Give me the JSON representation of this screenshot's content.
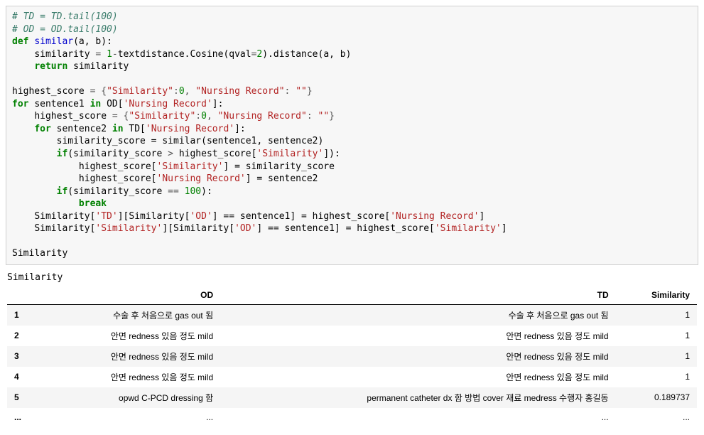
{
  "code": {
    "c1": "# TD = TD.tail(100)",
    "c2": "# OD = OD.tail(100)",
    "def": "def",
    "fn_similar": "similar",
    "args_ab": "(a, b):",
    "sim_var": "similarity",
    "eq": " = ",
    "one": "1",
    "minus": "-",
    "textdistance": "textdistance.Cosine(qval",
    "eq2": "=",
    "two": "2",
    "cosine_tail": ").distance(a, b)",
    "ret": "return",
    "hs": "highest_score",
    "dict_open": " = {",
    "k_sim": "\"Similarity\"",
    "colon": ":",
    "zero": "0",
    "comma": ", ",
    "k_nr": "\"Nursing Record\"",
    "empty": "\"\"",
    "dict_close": "}",
    "for": "for",
    "in": "in",
    "s1": "sentence1",
    "s2": "sentence2",
    "OD": "OD[",
    "TD": "TD[",
    "nr_key": "'Nursing Record'",
    "bracket_close": "]:",
    "ss": "similarity_score",
    "call_similar": " = similar(sentence1, sentence2)",
    "if": "if",
    "gt": " > ",
    "sim_key": "'Similarity'",
    "rb": "]):",
    "assign_ss": " = similarity_score",
    "assign_s2": " = sentence2",
    "eqeq": " == ",
    "hundred": "100",
    "rparen": "):",
    "break": "break",
    "Sim": "Similarity[",
    "td_key": "'TD'",
    "od_key": "'OD'",
    "mid1": "][Similarity[",
    "mid2": "] == sentence1] = highest_score[",
    "close1": "]",
    "sim_key2": "'Similarity'",
    "last": "Similarity"
  },
  "output_text": "Similarity",
  "table": {
    "columns": [
      "",
      "OD",
      "TD",
      "Similarity"
    ],
    "rows": [
      {
        "idx": "1",
        "od": "수술 후 처음으로 gas out 됨",
        "td": "수술 후 처음으로 gas out 됨",
        "sim": "1"
      },
      {
        "idx": "2",
        "od": "안면 redness 있음 정도 mild",
        "td": "안면 redness 있음 정도 mild",
        "sim": "1"
      },
      {
        "idx": "3",
        "od": "안면 redness 있음 정도 mild",
        "td": "안면 redness 있음 정도 mild",
        "sim": "1"
      },
      {
        "idx": "4",
        "od": "안면 redness 있음 정도 mild",
        "td": "안면 redness 있음 정도 mild",
        "sim": "1"
      },
      {
        "idx": "5",
        "od": "opwd C-PCD dressing 함",
        "td": "permanent catheter dx 함 방법 cover 재료 medress 수행자 홍길동",
        "sim": "0.189737"
      }
    ],
    "ellipsis": "..."
  }
}
